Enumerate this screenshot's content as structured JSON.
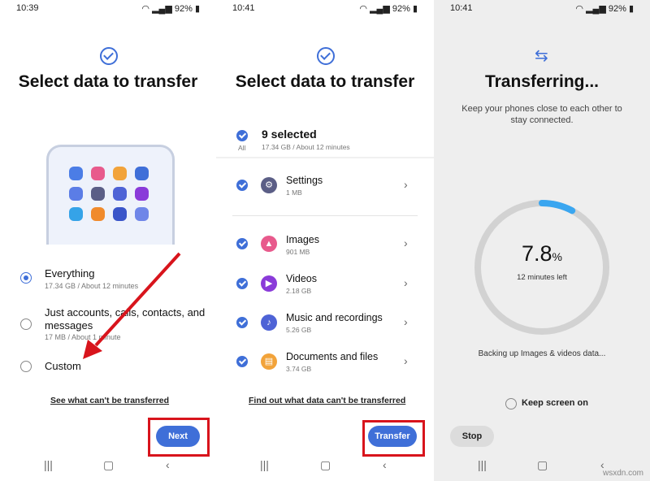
{
  "screens": [
    {
      "status": {
        "time": "10:39",
        "battery": "92%"
      },
      "title": "Select data to transfer",
      "options": [
        {
          "label": "Everything",
          "sub": "17.34 GB / About 12 minutes",
          "selected": true
        },
        {
          "label_line1": "Just accounts, calls, contacts, and",
          "label_line2": "messages",
          "sub": "17 MB / About 1 minute",
          "selected": false
        },
        {
          "label": "Custom",
          "selected": false
        }
      ],
      "link": "See what can't be transferred",
      "button": "Next"
    },
    {
      "status": {
        "time": "10:41",
        "battery": "92%"
      },
      "title": "Select data to transfer",
      "summary": {
        "all_label": "All",
        "selected": "9 selected",
        "sub": "17.34 GB / About 12 minutes"
      },
      "items": [
        {
          "title": "Settings",
          "sub": "1 MB",
          "icon": "gear-icon",
          "color": "#5b5e86"
        },
        {
          "title": "Images",
          "sub": "901 MB",
          "icon": "image-icon",
          "color": "#e85a8c"
        },
        {
          "title": "Videos",
          "sub": "2.18 GB",
          "icon": "play-icon",
          "color": "#8a3bd9"
        },
        {
          "title": "Music and recordings",
          "sub": "5.26 GB",
          "icon": "music-note-icon",
          "color": "#4e63d6"
        },
        {
          "title": "Documents and files",
          "sub": "3.74 GB",
          "icon": "document-icon",
          "color": "#f2a33a"
        }
      ],
      "link": "Find out what data can't be transferred",
      "button": "Transfer"
    },
    {
      "status": {
        "time": "10:41",
        "battery": "92%"
      },
      "title": "Transferring...",
      "subtitle_line1": "Keep your phones close to each other to",
      "subtitle_line2": "stay connected.",
      "progress": {
        "value": "7.8",
        "unit": "%",
        "fraction": 0.078,
        "time_left": "12 minutes left"
      },
      "status_text": "Backing up Images & videos data...",
      "keep_screen": "Keep screen on",
      "stop": "Stop"
    }
  ],
  "watermark": "wsxdn.com",
  "colors": {
    "accent": "#3f6fd8",
    "highlight_box": "#d8141c"
  }
}
